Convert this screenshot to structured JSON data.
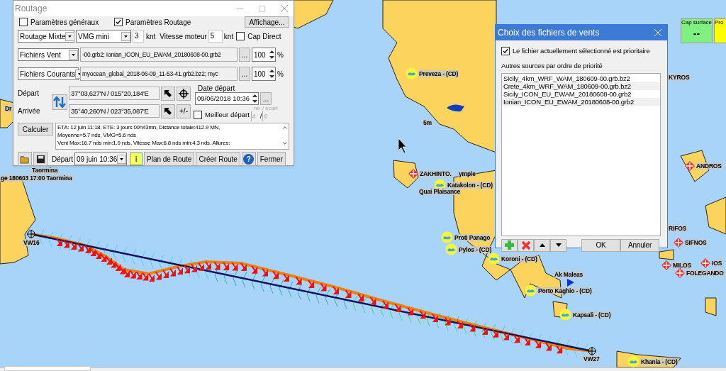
{
  "routage_window": {
    "title": "Routage",
    "general_params": {
      "label": "Paramètres généraux",
      "checked": false
    },
    "routing_params": {
      "label": "Paramètres Routage",
      "checked": true
    },
    "display_button": "Affichage...",
    "mode_select": "Routage Mixte",
    "vmg_select": "VMG mini",
    "vmg_value": "3",
    "vmg_unit": "knt",
    "engine_label": "Vitesse moteur",
    "engine_value": "5",
    "engine_unit": "knt",
    "cap_direct": {
      "label": "Cap Direct",
      "checked": false
    },
    "files": [
      {
        "select": "Fichiers Vent",
        "value": "-00.grb2; Ionian_ICON_EU_EWAM_20180608-00.grb2",
        "browse": "...",
        "percent": "100",
        "unit": "%"
      },
      {
        "select": "Fichiers Courants",
        "value": "myocean_global_2018-06-09_11-53-41.grb2.bz2; myc",
        "browse": "...",
        "percent": "100",
        "unit": "%"
      }
    ],
    "start_label": "Départ",
    "start_value": "37°03,627'N / 015°20,184'E",
    "end_label": "Arrivée",
    "end_value": "35°40,260'N / 023°35,087'E",
    "plusminus": "+/-",
    "date_label": "Date départ",
    "date_value": "09/06/2018 10:36",
    "date_browse": "...",
    "best_start": {
      "label": "Meilleur départ",
      "checked": false
    },
    "nb_label": "nb",
    "gap_label": "/ écart",
    "nb_value": "4",
    "slash": "/",
    "gap_value": "6",
    "compute_button": "Calculer",
    "result_lines": [
      "ETA: 12 juin 11:18, ETE: 3 jours 00h43mn, Distance totale:412.9 MN,",
      "Moyenne=5.7 nds, VMG=5.6 nds",
      "Vent Max:16.7 nds min:1.9 nds, Vitesse Max:6.8 nds min:4.3 nds. Allures:"
    ],
    "depart_label": "Départ",
    "depart_select": "09 juin 10:36",
    "info_button": "i",
    "buttons": [
      "Plan de Route",
      "Créer Route"
    ],
    "help_button": "?",
    "close_button": "Fermer"
  },
  "wind_dialog": {
    "title": "Choix des fichiers de vents",
    "priority": {
      "label": "Le fichier actuellement sélectionné est prioritaire",
      "checked": true
    },
    "list_label": "Autres sources par ordre de priorité",
    "files": [
      "Sicily_4km_WRF_WAM_180609-00.grb.bz2",
      "Crete_4km_WRF_WAM_180609-00.grb.bz2",
      "Sicily_ICON_EU_EWAM_20180608-00.grb2",
      "Ionian_ICON_EU_EWAM_20180608-00.grb2"
    ],
    "ok": "OK",
    "cancel": "Annuler"
  },
  "instruments": [
    {
      "label": "Cap surface",
      "value": "--",
      "color": "#80f080"
    },
    {
      "label": "Pro",
      "color": "#ffff00"
    }
  ],
  "map_labels": [
    {
      "text": "Taormina",
      "kind": "place"
    },
    {
      "text": "ge 180603 17:00 Taormina",
      "kind": "place"
    },
    {
      "text": "Dr",
      "kind": "place"
    },
    {
      "text": "Preveza -  (CD)",
      "kind": "port"
    },
    {
      "text": "5m",
      "kind": "place"
    },
    {
      "text": "ZAKHINTO.",
      "kind": "island"
    },
    {
      "text": "ympie",
      "kind": "place"
    },
    {
      "text": "Katakolon -  (CD)",
      "kind": "port"
    },
    {
      "text": "Quai Plaisance",
      "kind": "place"
    },
    {
      "text": "Proti Panago",
      "kind": "port"
    },
    {
      "text": "Pylos -  (CD)",
      "kind": "port"
    },
    {
      "text": "Koroni -  (CD)",
      "kind": "port"
    },
    {
      "text": "Ak Maleas",
      "kind": "place"
    },
    {
      "text": "Porto Kaghio -  (CD)",
      "kind": "port"
    },
    {
      "text": "Kapsali -  (CD)",
      "kind": "port"
    },
    {
      "text": "VW16",
      "kind": "waypoint"
    },
    {
      "text": "VW27",
      "kind": "waypoint"
    },
    {
      "text": "Khania -  (CD)",
      "kind": "port"
    },
    {
      "text": "KYROS",
      "kind": "place"
    },
    {
      "text": "ANDROS",
      "kind": "island"
    },
    {
      "text": "RIFOS",
      "kind": "place"
    },
    {
      "text": "SIFNOS",
      "kind": "island"
    },
    {
      "text": "MILOS",
      "kind": "island"
    },
    {
      "text": "IOS",
      "kind": "island"
    },
    {
      "text": "FOLEGANDO",
      "kind": "island"
    }
  ]
}
